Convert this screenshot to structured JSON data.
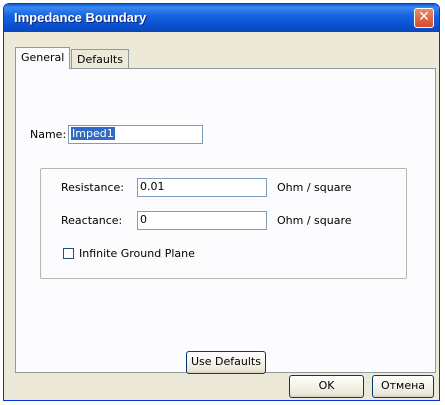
{
  "window": {
    "title": "Impedance Boundary",
    "close_glyph": "✕"
  },
  "tabs": [
    {
      "label": "General",
      "active": true
    },
    {
      "label": "Defaults",
      "active": false
    }
  ],
  "general": {
    "name_label": "Name:",
    "name_value": "Imped1",
    "resistance_label": "Resistance:",
    "resistance_value": "0.01",
    "resistance_unit": "Ohm / square",
    "reactance_label": "Reactance:",
    "reactance_value": "0",
    "reactance_unit": "Ohm / square",
    "infinite_ground_label": "Infinite Ground Plane",
    "infinite_ground_checked": false,
    "use_defaults_label": "Use Defaults"
  },
  "footer": {
    "ok_label": "OK",
    "cancel_label": "Отмена"
  },
  "colors": {
    "titlebar": "#0a4fcf",
    "dialog_bg": "#ece9d8",
    "selection": "#316ac5"
  }
}
